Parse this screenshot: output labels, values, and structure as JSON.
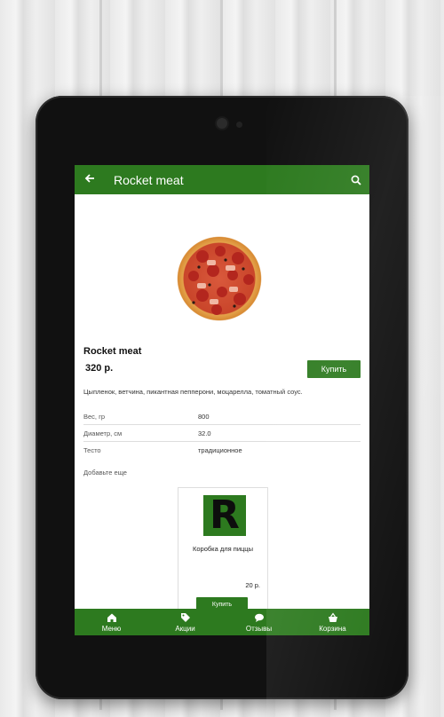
{
  "header": {
    "title": "Rocket meat"
  },
  "product": {
    "name": "Rocket meat",
    "price": "320 р.",
    "buy_label": "Купить",
    "description": "Цыпленок, ветчина, пикантная пепперони, моцарелла, томатный соус.",
    "specs": [
      {
        "label": "Вес, гр",
        "value": "800"
      },
      {
        "label": "Диаметр, см",
        "value": "32.0"
      },
      {
        "label": "Тесто",
        "value": "традиционное"
      }
    ]
  },
  "addons": {
    "heading": "Добавьте еще",
    "items": [
      {
        "name": "Коробка для пиццы",
        "price": "20 р.",
        "buy_label": "Купить",
        "logo_letter": "R"
      }
    ],
    "scroll_hint": "⟷"
  },
  "bottom_nav": [
    {
      "label": "Меню",
      "icon": "home-icon"
    },
    {
      "label": "Акции",
      "icon": "tag-icon"
    },
    {
      "label": "Отзывы",
      "icon": "chat-icon"
    },
    {
      "label": "Корзина",
      "icon": "basket-icon"
    }
  ],
  "colors": {
    "accent": "#2d7a1f"
  }
}
